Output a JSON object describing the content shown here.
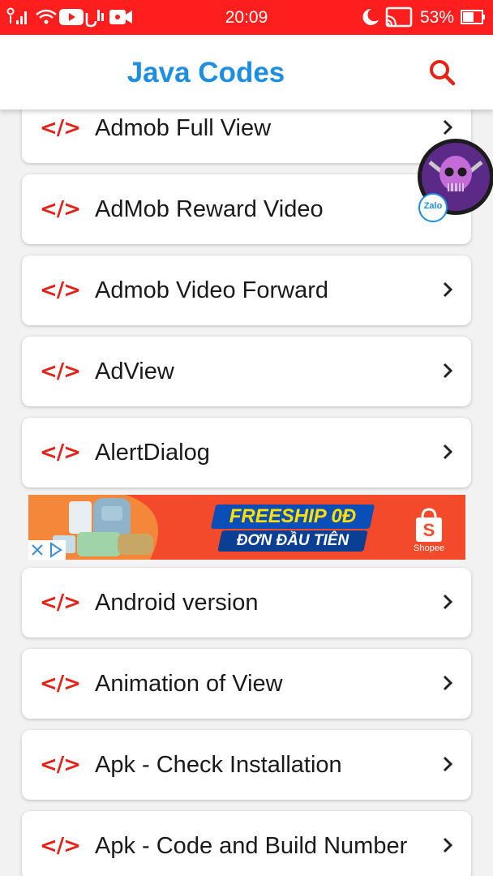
{
  "status_bar": {
    "time": "20:09",
    "battery_percent": "53%"
  },
  "app_bar": {
    "title": "Java Codes",
    "search_icon": "search-icon"
  },
  "list_items": [
    {
      "label": "Admob Full View"
    },
    {
      "label": "AdMob Reward Video"
    },
    {
      "label": "Admob Video Forward"
    },
    {
      "label": "AdView"
    },
    {
      "label": "AlertDialog"
    },
    {
      "label": "Android version"
    },
    {
      "label": "Animation of View"
    },
    {
      "label": "Apk - Check Installation"
    },
    {
      "label": "Apk - Code and Build Number"
    }
  ],
  "item_icon": "</>",
  "ad": {
    "headline": "FREESHIP 0Đ",
    "subline": "ĐƠN ĐẦU TIÊN",
    "brand": "Shopee"
  },
  "chat_head": {
    "badge": "Zalo"
  },
  "colors": {
    "status_bar": "#ff1e1e",
    "title": "#1e8fe0",
    "code_icon": "#e62117",
    "search_icon": "#e62117"
  }
}
